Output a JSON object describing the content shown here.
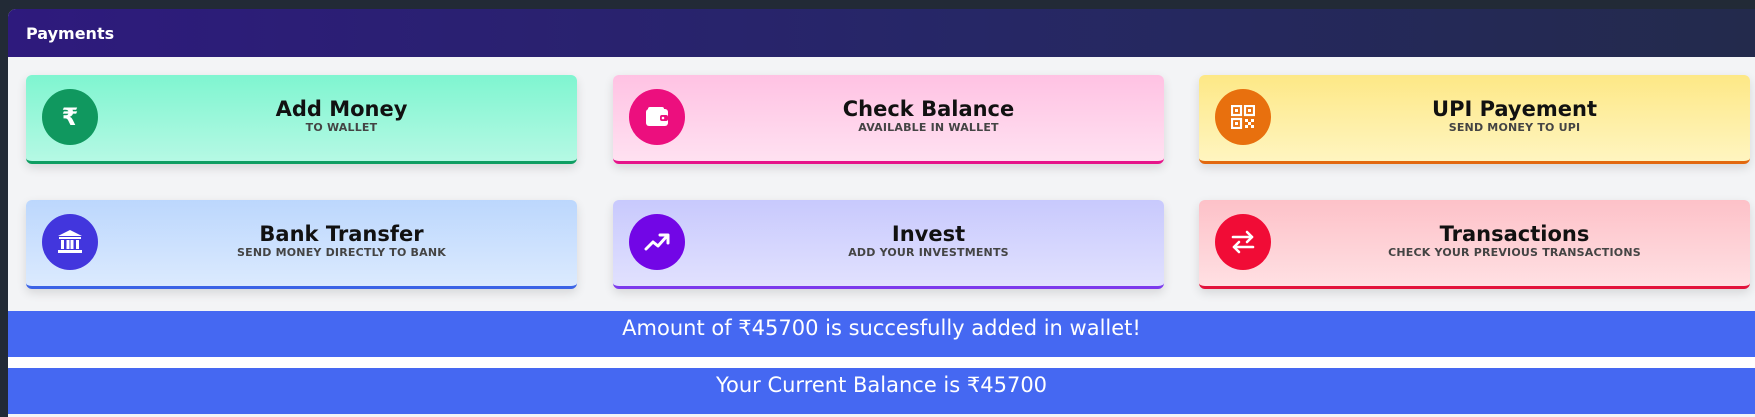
{
  "header": {
    "title": "Payments"
  },
  "cards": [
    {
      "title": "Add Money",
      "subtitle": "TO WALLET",
      "icon": "rupee-icon",
      "circle": "#10985f"
    },
    {
      "title": "Check Balance",
      "subtitle": "AVAILABLE IN WALLET",
      "icon": "wallet-icon",
      "circle": "#ec0f7e"
    },
    {
      "title": "UPI Payement",
      "subtitle": "SEND MONEY TO UPI",
      "icon": "qr-code-icon",
      "circle": "#e8700e"
    },
    {
      "title": "Bank Transfer",
      "subtitle": "SEND MONEY DIRECTLY TO BANK",
      "icon": "bank-icon",
      "circle": "#4236dd"
    },
    {
      "title": "Invest",
      "subtitle": "ADD YOUR INVESTMENTS",
      "icon": "trending-up-icon",
      "circle": "#7206e6"
    },
    {
      "title": "Transactions",
      "subtitle": "CHECK YOUR PREVIOUS TRANSACTIONS",
      "icon": "swap-arrows-icon",
      "circle": "#f10c36"
    }
  ],
  "messages": {
    "added": "Amount of ₹45700 is succesfully added in wallet!",
    "balance": "Your Current Balance is ₹45700"
  },
  "colors": {
    "banner": "#4568f2",
    "header": "#2a2370"
  }
}
